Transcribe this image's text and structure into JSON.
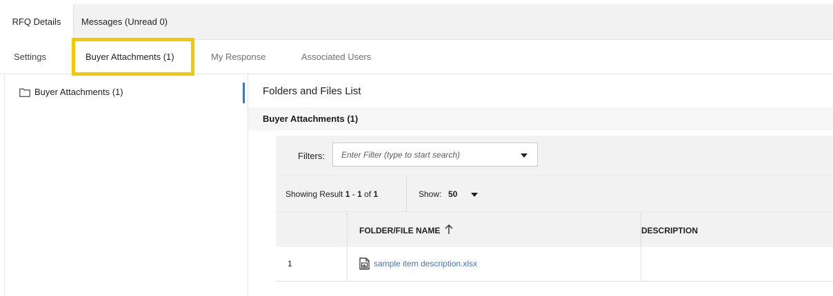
{
  "primary_tabs": [
    {
      "label": "RFQ Details",
      "active": true
    },
    {
      "label": "Messages (Unread 0)",
      "active": false
    }
  ],
  "secondary_tabs": [
    {
      "label": "Settings"
    },
    {
      "label": "Buyer Attachments (1)",
      "active": true
    },
    {
      "label": "My Response"
    },
    {
      "label": "Associated Users"
    }
  ],
  "tree": {
    "items": [
      {
        "label": "Buyer Attachments (1)",
        "icon": "folder-icon"
      }
    ]
  },
  "main": {
    "title": "Folders and Files List",
    "section_title": "Buyer Attachments (1)"
  },
  "filters": {
    "label": "Filters:",
    "placeholder": "Enter Filter (type to start search)"
  },
  "results": {
    "prefix": "Showing Result",
    "from": "1",
    "dash": "-",
    "to": "1",
    "of_label": "of",
    "total": "1",
    "show_label": "Show:",
    "show_value": "50"
  },
  "table": {
    "columns": [
      "",
      "FOLDER/FILE NAME",
      "DESCRIPTION"
    ],
    "rows": [
      {
        "index": "1",
        "name": "sample item description.xlsx",
        "description": "",
        "icon": "spreadsheet-file-icon"
      }
    ]
  },
  "colors": {
    "highlight": "#f5c900",
    "link": "#3b74c9",
    "accent": "#3b74c9"
  }
}
